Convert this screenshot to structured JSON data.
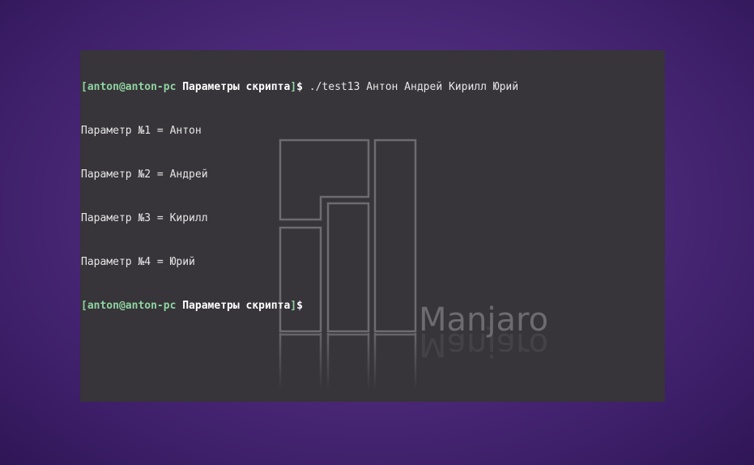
{
  "terminal": {
    "prompt": {
      "open_bracket": "[",
      "user_host": "anton@anton-pc",
      "directory": "Параметры скрипта",
      "close_bracket": "]",
      "dollar": "$"
    },
    "command": " ./test13 Антон Андрей Кирилл Юрий",
    "output": [
      "Параметр №1 = Антон",
      "Параметр №2 = Андрей",
      "Параметр №3 = Кирилл",
      "Параметр №4 = Юрий"
    ]
  },
  "wallpaper": {
    "logo_text": "Manjaro"
  },
  "colors": {
    "background": "#4c2a7a",
    "terminal_bg": "#37343a",
    "prompt_green": "#8fd4a0",
    "text": "#e6e6e6"
  }
}
